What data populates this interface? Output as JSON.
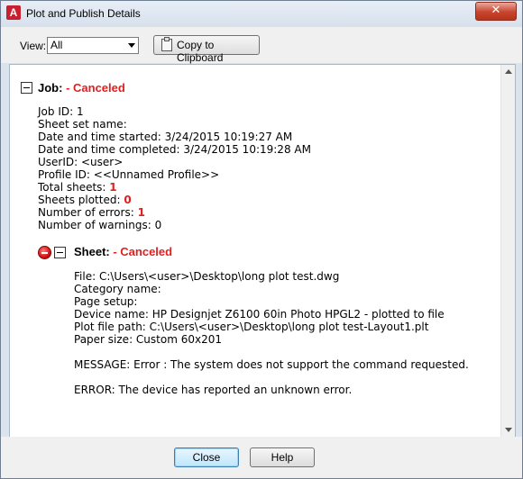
{
  "window": {
    "title": "Plot and Publish Details",
    "app_icon_letter": "A",
    "close_glyph": "✕"
  },
  "toolbar": {
    "view_label": "View:",
    "view_selected": "All",
    "copy_button": "Copy to Clipboard"
  },
  "job": {
    "label": "Job:",
    "status": " - Canceled",
    "job_id": "Job ID: 1",
    "sheet_set_name": "Sheet set name:",
    "date_started": "Date and time started: 3/24/2015 10:19:27 AM",
    "date_completed": "Date and time completed: 3/24/2015 10:19:28 AM",
    "user_id": "UserID: <user>",
    "profile_id": "Profile ID: <<Unnamed Profile>>",
    "total_sheets_label": "Total sheets: ",
    "total_sheets_value": "1",
    "sheets_plotted_label": "Sheets plotted: ",
    "sheets_plotted_value": "0",
    "errors_label": "Number of errors: ",
    "errors_value": "1",
    "warnings": "Number of warnings: 0"
  },
  "sheet": {
    "label": "Sheet:",
    "status": " - Canceled",
    "file": "File: C:\\Users\\<user>\\Desktop\\long plot test.dwg",
    "category": "Category name:",
    "page_setup": "Page setup:",
    "device": "Device name: HP Designjet Z6100 60in Photo HPGL2 - plotted to file",
    "plot_path": "Plot file path: C:\\Users\\<user>\\Desktop\\long plot test-Layout1.plt",
    "paper_size": "Paper size: Custom 60x201",
    "message": "MESSAGE: Error : The system does not support the command requested.",
    "error": "ERROR: The device has reported an unknown error."
  },
  "footer": {
    "close_button": "Close",
    "help_button": "Help"
  },
  "colors": {
    "status_red": "#e02020",
    "title_close_red": "#c7442d"
  }
}
